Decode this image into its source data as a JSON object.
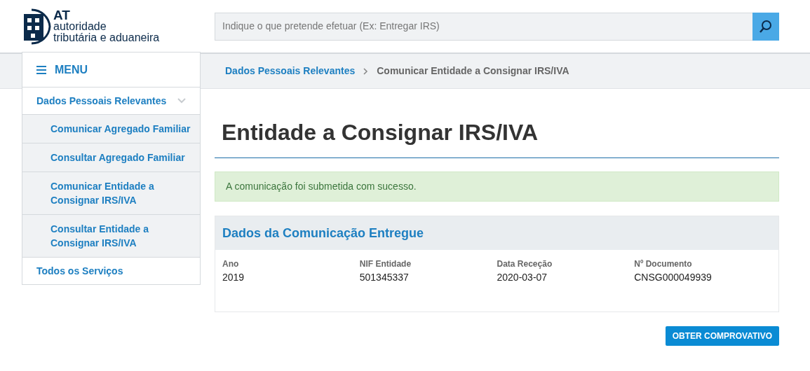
{
  "logo": {
    "abbr": "AT",
    "line1": "autoridade",
    "line2": "tributária e aduaneira"
  },
  "search": {
    "placeholder": "Indique o que pretende efetuar (Ex: Entregar IRS)"
  },
  "menu": {
    "label": "MENU"
  },
  "breadcrumb": [
    "Dados Pessoais Relevantes",
    "Comunicar Entidade a Consignar IRS/IVA"
  ],
  "sidebar": {
    "items": [
      {
        "label": "Dados Pessoais Relevantes",
        "expanded": true,
        "children": [
          {
            "label": "Comunicar Agregado Familiar"
          },
          {
            "label": "Consultar Agregado Familiar"
          },
          {
            "label": "Comunicar Entidade a Consignar IRS/IVA"
          },
          {
            "label": "Consultar Entidade a Consignar IRS/IVA"
          }
        ]
      },
      {
        "label": "Todos os Serviços"
      }
    ]
  },
  "page_title": "Entidade a Consignar IRS/IVA",
  "alert": {
    "kind": "success",
    "text": "A comunicação foi submetida com sucesso."
  },
  "panel": {
    "title": "Dados da Comunicação Entregue",
    "fields": [
      {
        "label": "Ano",
        "value": "2019"
      },
      {
        "label": "NIF Entidade",
        "value": "501345337"
      },
      {
        "label": "Data Receção",
        "value": "2020-03-07"
      },
      {
        "label": "Nº Documento",
        "value": "CNSG000049939"
      }
    ]
  },
  "button": "OBTER COMPROVATIVO"
}
